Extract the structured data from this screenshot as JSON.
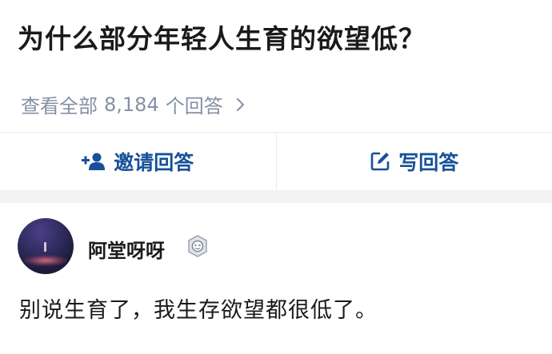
{
  "question": {
    "title": "为什么部分年轻人生育的欲望低？",
    "view_all_prefix": "查看全部",
    "answer_count": "8,184",
    "view_all_suffix": "个回答"
  },
  "actions": {
    "invite_label": "邀请回答",
    "write_label": "写回答",
    "accent_color": "#175199"
  },
  "answer": {
    "author_name": "阿堂呀呀",
    "text": "别说生育了，我生存欲望都很低了。"
  },
  "icons": {
    "invite": "add-user-icon",
    "write": "edit-icon",
    "view_all": "chevron-right-icon",
    "badge": "badge-icon"
  }
}
